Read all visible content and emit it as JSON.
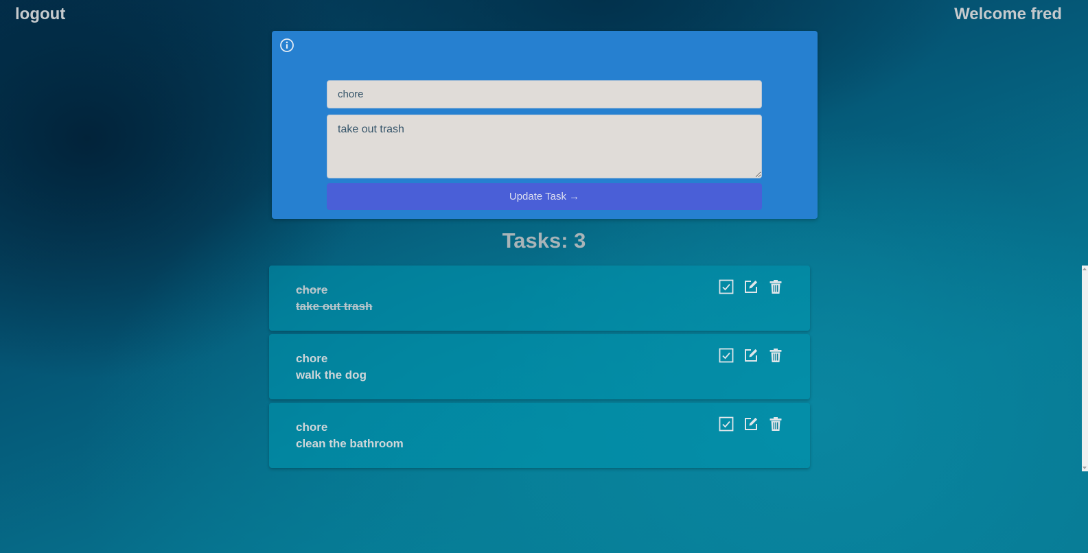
{
  "header": {
    "logout_label": "logout",
    "welcome_text": "Welcome fred"
  },
  "form": {
    "title_value": "chore",
    "description_value": "take out trash",
    "submit_label": "Update Task →"
  },
  "tasks_heading": "Tasks: 3",
  "tasks": [
    {
      "title": "chore",
      "description": "take out trash",
      "completed": true
    },
    {
      "title": "chore",
      "description": "walk the dog",
      "completed": false
    },
    {
      "title": "chore",
      "description": "clean the bathroom",
      "completed": false
    }
  ],
  "icons": {
    "info": "info-icon",
    "complete": "checkbox-icon",
    "edit": "edit-icon",
    "delete": "trash-icon"
  },
  "colors": {
    "form_card": "#2680d0",
    "button": "#4a5fd7",
    "input_bg": "#e0dcd8"
  }
}
